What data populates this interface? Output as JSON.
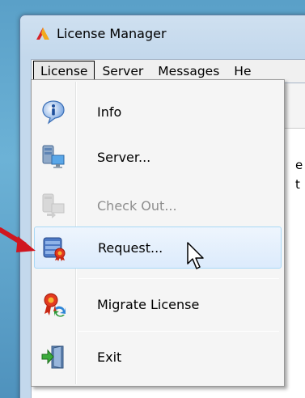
{
  "window": {
    "title": "License Manager",
    "icon": "license-manager-app-icon"
  },
  "menubar": {
    "items": [
      {
        "label": "License"
      },
      {
        "label": "Server"
      },
      {
        "label": "Messages"
      },
      {
        "label": "He"
      }
    ]
  },
  "background": {
    "partial_text_1": "e",
    "partial_text_2": "t"
  },
  "dropdown": {
    "items": [
      {
        "label": "Info",
        "icon": "info-icon",
        "enabled": true
      },
      {
        "label": "Server...",
        "icon": "server-icon",
        "enabled": true
      },
      {
        "label": "Check Out...",
        "icon": "check-out-icon",
        "enabled": false
      },
      {
        "label": "Request...",
        "icon": "request-icon",
        "enabled": true,
        "highlighted": true
      },
      {
        "label": "Migrate License",
        "icon": "migrate-license-icon",
        "enabled": true
      },
      {
        "label": "Exit",
        "icon": "exit-icon",
        "enabled": true
      }
    ]
  },
  "colors": {
    "annotation_arrow": "#d01620",
    "highlight_border": "#a8d8f6"
  }
}
